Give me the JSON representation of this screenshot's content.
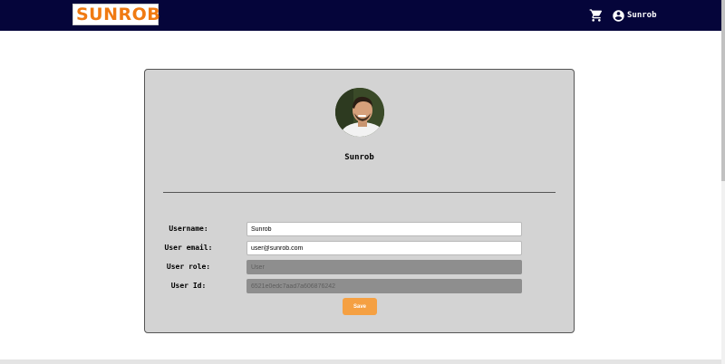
{
  "header": {
    "logo_text": "SUNROB",
    "user_name": "Sunrob"
  },
  "icons": {
    "cart": "cart-icon",
    "account": "account-circle-icon"
  },
  "profile": {
    "name": "Sunrob"
  },
  "form": {
    "username_label": "Username:",
    "username_value": "Sunrob",
    "email_label": "User email:",
    "email_value": "user@sunrob.com",
    "role_label": "User role:",
    "role_value": "User",
    "id_label": "User Id:",
    "id_value": "6521e0edc7aad7a606876242",
    "save_label": "Save"
  },
  "colors": {
    "navbar": "#05053a",
    "brand": "#f07a12",
    "card": "#d3d3d3",
    "save_button": "#f5a042",
    "disabled_field": "#8e8e8e"
  }
}
